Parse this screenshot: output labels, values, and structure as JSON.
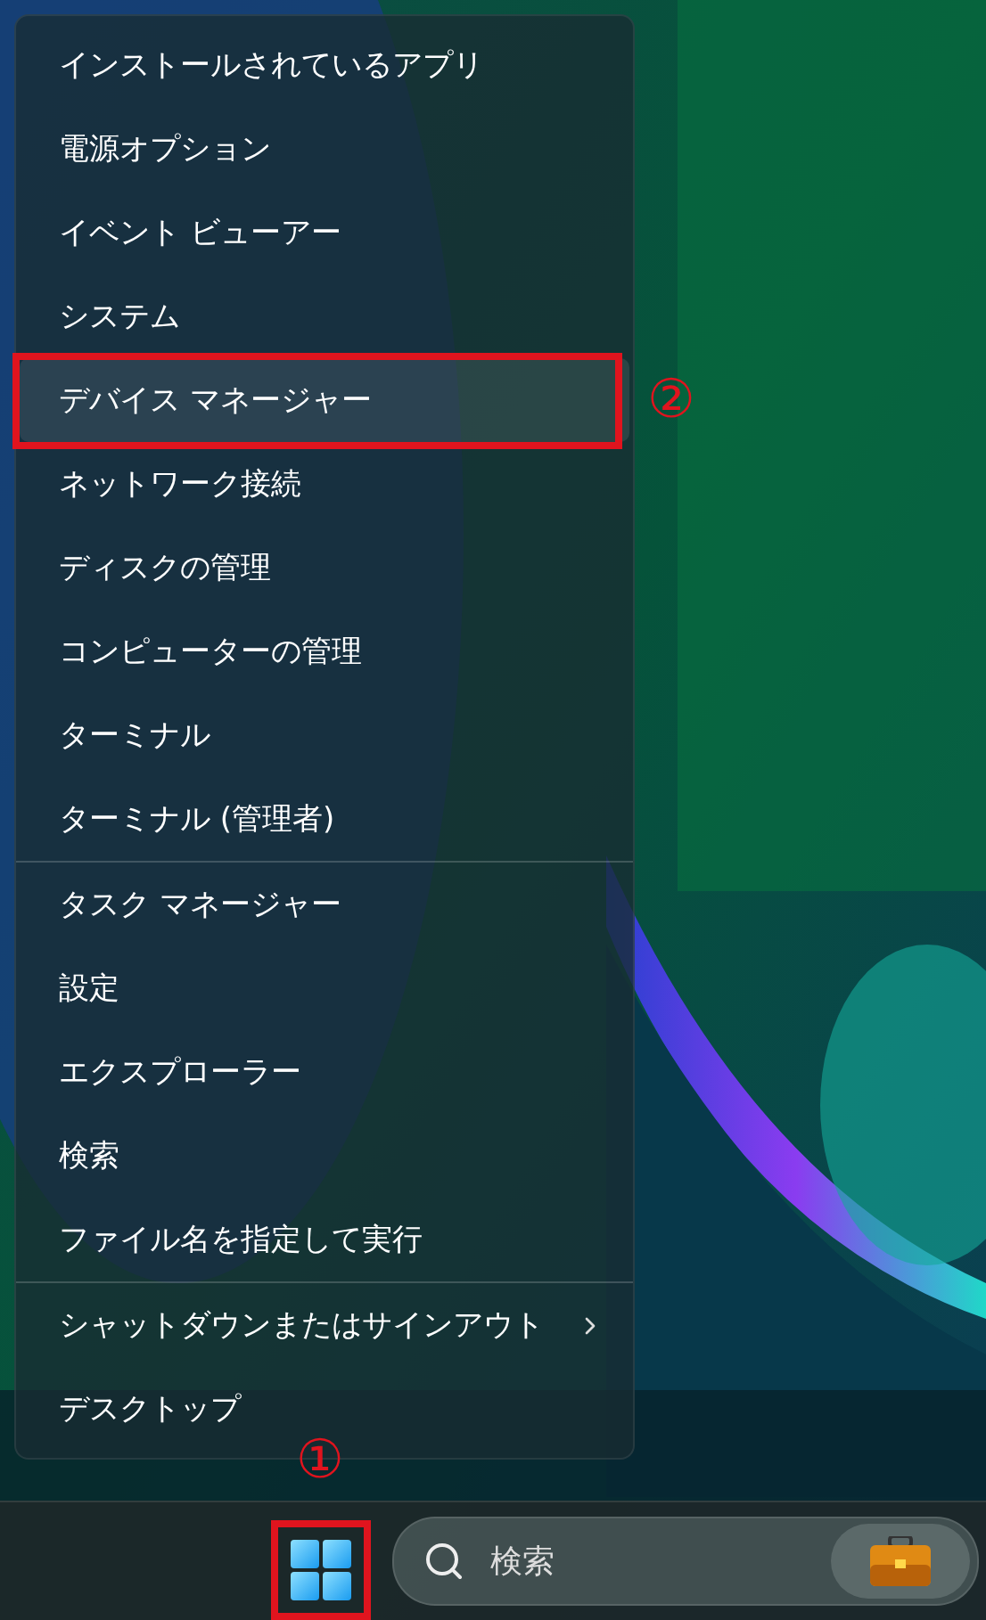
{
  "menu": {
    "groups": [
      {
        "items": [
          {
            "label": "インストールされているアプリ",
            "selected": false,
            "submenu": false
          },
          {
            "label": "電源オプション",
            "selected": false,
            "submenu": false
          },
          {
            "label": "イベント ビューアー",
            "selected": false,
            "submenu": false
          },
          {
            "label": "システム",
            "selected": false,
            "submenu": false
          },
          {
            "label": "デバイス マネージャー",
            "selected": true,
            "submenu": false,
            "annotation": "②"
          },
          {
            "label": "ネットワーク接続",
            "selected": false,
            "submenu": false
          },
          {
            "label": "ディスクの管理",
            "selected": false,
            "submenu": false
          },
          {
            "label": "コンピューターの管理",
            "selected": false,
            "submenu": false
          },
          {
            "label": "ターミナル",
            "selected": false,
            "submenu": false
          },
          {
            "label": "ターミナル (管理者)",
            "selected": false,
            "submenu": false
          }
        ]
      },
      {
        "items": [
          {
            "label": "タスク マネージャー",
            "selected": false,
            "submenu": false
          },
          {
            "label": "設定",
            "selected": false,
            "submenu": false
          },
          {
            "label": "エクスプローラー",
            "selected": false,
            "submenu": false
          },
          {
            "label": "検索",
            "selected": false,
            "submenu": false
          },
          {
            "label": "ファイル名を指定して実行",
            "selected": false,
            "submenu": false
          }
        ]
      },
      {
        "items": [
          {
            "label": "シャットダウンまたはサインアウト",
            "selected": false,
            "submenu": true
          },
          {
            "label": "デスクトップ",
            "selected": false,
            "submenu": false
          }
        ]
      }
    ]
  },
  "taskbar": {
    "start_button": {
      "annotation": "①"
    },
    "search": {
      "placeholder": "検索"
    }
  }
}
